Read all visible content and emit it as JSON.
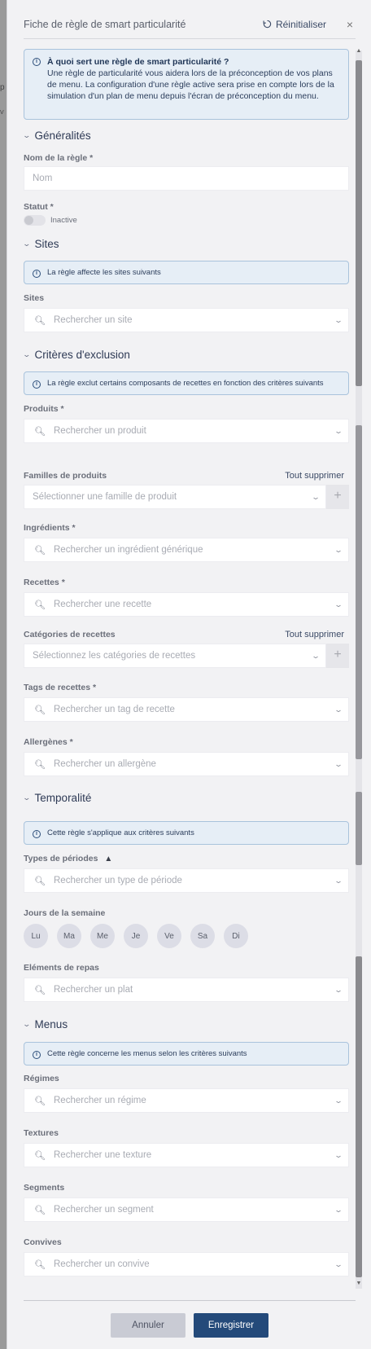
{
  "panel": {
    "title": "Fiche de règle de smart particularité",
    "reset_label": "Réinitialiser",
    "close_glyph": "×"
  },
  "intro": {
    "question": "À quoi sert une règle de smart particularité ?",
    "text": "Une règle de particularité vous aidera lors de la préconception de vos plans de menu. La configuration d'une règle active sera prise en compte lors de la simulation d'un plan de menu depuis l'écran de préconception du menu."
  },
  "general": {
    "heading": "Généralités",
    "name_label": "Nom de la règle *",
    "name_placeholder": "Nom",
    "status_label": "Statut *",
    "status_value": "Inactive"
  },
  "sites": {
    "heading": "Sites",
    "info": "La règle affecte les sites suivants",
    "field_label": "Sites",
    "placeholder": "Rechercher un site"
  },
  "exclusion": {
    "heading": "Critères d'exclusion",
    "info": "La règle exclut certains composants de recettes en fonction des critères suivants",
    "products_label": "Produits *",
    "products_placeholder": "Rechercher un produit",
    "families_label": "Familles de produits",
    "families_clear": "Tout supprimer",
    "families_placeholder": "Sélectionner une famille de produit",
    "ingredients_label": "Ingrédients *",
    "ingredients_placeholder": "Rechercher un ingrédient générique",
    "recipes_label": "Recettes *",
    "recipes_placeholder": "Rechercher une recette",
    "recipe_categories_label": "Catégories de recettes",
    "recipe_categories_clear": "Tout supprimer",
    "recipe_categories_placeholder": "Sélectionnez les catégories de recettes",
    "recipe_tags_label": "Tags de recettes *",
    "recipe_tags_placeholder": "Rechercher un tag de recette",
    "allergens_label": "Allergènes *",
    "allergens_placeholder": "Rechercher un allergène"
  },
  "temporality": {
    "heading": "Temporalité",
    "info": "Cette règle s'applique aux critères suivants",
    "periods_label": "Types de périodes",
    "periods_placeholder": "Rechercher un type de période",
    "weekdays_label": "Jours de la semaine",
    "weekdays": [
      "Lu",
      "Ma",
      "Me",
      "Je",
      "Ve",
      "Sa",
      "Di"
    ],
    "meal_elements_label": "Eléments de repas",
    "meal_elements_placeholder": "Rechercher un plat"
  },
  "menus": {
    "heading": "Menus",
    "info": "Cette règle concerne les menus selon les critères suivants",
    "diets_label": "Régimes",
    "diets_placeholder": "Rechercher un régime",
    "textures_label": "Textures",
    "textures_placeholder": "Rechercher une texture",
    "segments_label": "Segments",
    "segments_placeholder": "Rechercher un segment",
    "guests_label": "Convives",
    "guests_placeholder": "Rechercher un convive"
  },
  "footer": {
    "cancel_label": "Annuler",
    "save_label": "Enregistrer"
  },
  "icons": {
    "search": "search-icon",
    "chevron": "chevron-down-icon",
    "info": "info-icon",
    "warning": "warning-icon",
    "reset": "reset-icon",
    "close": "close-icon",
    "plus": "plus-icon"
  },
  "colors": {
    "accent": "#244a7a",
    "info_bg": "#e6eef6",
    "panel_bg": "#f2f2f4"
  }
}
